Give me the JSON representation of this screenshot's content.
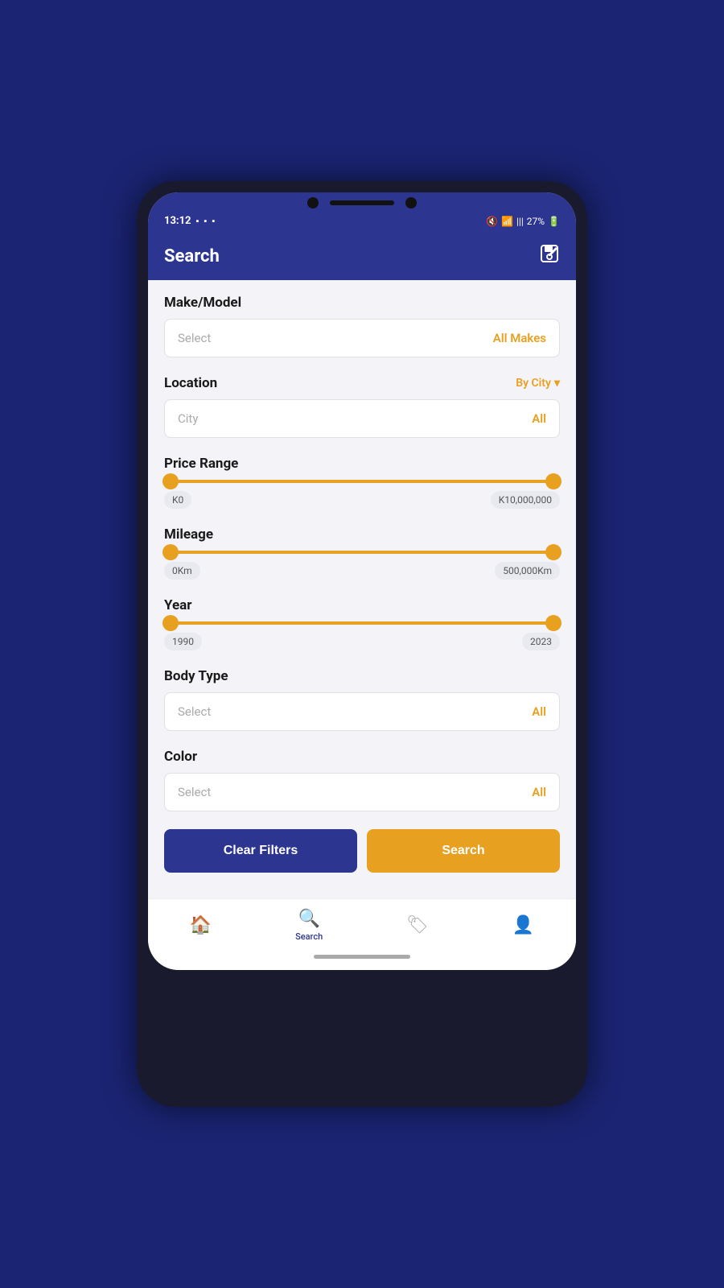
{
  "status_bar": {
    "time": "13:12",
    "battery": "27%"
  },
  "app_bar": {
    "title": "Search",
    "icon_label": "save-edit-icon"
  },
  "make_model": {
    "section_title": "Make/Model",
    "placeholder": "Select",
    "value_right": "All Makes"
  },
  "location": {
    "section_title": "Location",
    "by_city_label": "By City",
    "placeholder": "City",
    "value_right": "All"
  },
  "price_range": {
    "section_title": "Price Range",
    "min_label": "K0",
    "max_label": "K10,000,000"
  },
  "mileage": {
    "section_title": "Mileage",
    "min_label": "0Km",
    "max_label": "500,000Km"
  },
  "year": {
    "section_title": "Year",
    "min_label": "1990",
    "max_label": "2023"
  },
  "body_type": {
    "section_title": "Body Type",
    "placeholder": "Select",
    "value_right": "All"
  },
  "color": {
    "section_title": "Color",
    "placeholder": "Select",
    "value_right": "All"
  },
  "buttons": {
    "clear_filters": "Clear Filters",
    "search": "Search"
  },
  "bottom_nav": {
    "home_label": "Home",
    "search_label": "Search",
    "tags_label": "Tags",
    "profile_label": "Profile"
  }
}
